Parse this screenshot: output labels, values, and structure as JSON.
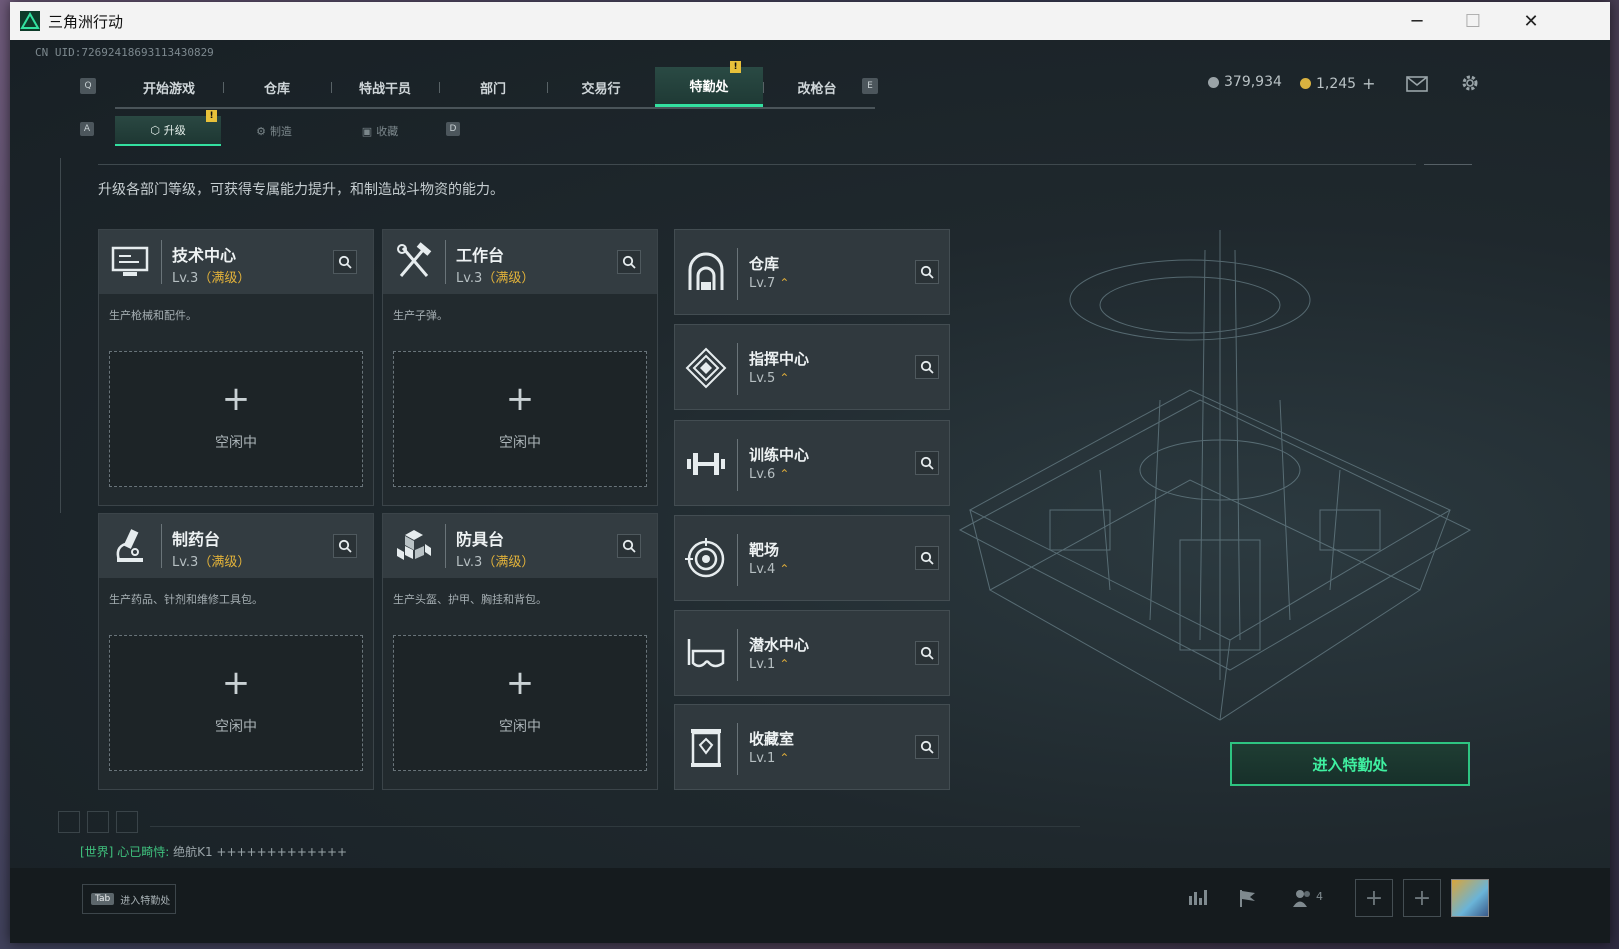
{
  "window": {
    "title": "三角洲行动",
    "minimize": "─",
    "maximize": "☐",
    "close": "✕"
  },
  "uid": "CN UID:726924186931134​30829",
  "nav": {
    "key_left": "Q",
    "key_right": "E",
    "tabs": [
      "开始游戏",
      "仓库",
      "特战干员",
      "部门",
      "交易行",
      "特勤处",
      "改枪台"
    ],
    "active_index": 5,
    "badge": "!"
  },
  "currency": {
    "coins": "379,934",
    "bonds": "1,245",
    "add": "+"
  },
  "subnav": {
    "key_left": "A",
    "key_right": "D",
    "tabs": [
      "升级",
      "制造",
      "收藏"
    ],
    "active_index": 0,
    "badge": "!"
  },
  "description": "升级各部门等级，可获得专属能力提升，和制造战斗物资的能力。",
  "workstations": [
    {
      "name": "技术中心",
      "level": "Lv.3",
      "max": "（满级）",
      "desc": "生产枪械和配件。",
      "icon": "computer-icon",
      "slot_plus": "+",
      "slot_status": "空闲中"
    },
    {
      "name": "工作台",
      "level": "Lv.3",
      "max": "（满级）",
      "desc": "生产子弹。",
      "icon": "tools-icon",
      "slot_plus": "+",
      "slot_status": "空闲中"
    },
    {
      "name": "制药台",
      "level": "Lv.3",
      "max": "（满级）",
      "desc": "生产药品、针剂和维修工具包。",
      "icon": "microscope-icon",
      "slot_plus": "+",
      "slot_status": "空闲中"
    },
    {
      "name": "防具台",
      "level": "Lv.3",
      "max": "（满级）",
      "desc": "生产头盔、护甲、胸挂和背包。",
      "icon": "armor-cubes-icon",
      "slot_plus": "+",
      "slot_status": "空闲中"
    }
  ],
  "departments": [
    {
      "name": "仓库",
      "level": "Lv.7",
      "icon": "warehouse-icon"
    },
    {
      "name": "指挥中心",
      "level": "Lv.5",
      "icon": "command-diamond-icon"
    },
    {
      "name": "训练中心",
      "level": "Lv.6",
      "icon": "dumbbell-icon"
    },
    {
      "name": "靶场",
      "level": "Lv.4",
      "icon": "target-icon"
    },
    {
      "name": "潜水中心",
      "level": "Lv.1",
      "icon": "diving-mask-icon"
    },
    {
      "name": "收藏室",
      "level": "Lv.1",
      "icon": "trophy-case-icon"
    }
  ],
  "upgrade_mark": "⌃",
  "enter_button": "进入特勤处",
  "chat": {
    "channel": "[世界]",
    "sender": "心已畸恃:",
    "message": "绝航K1 +++++++++++++"
  },
  "bottom": {
    "tab_key": "Tab",
    "tab_label": "进入特勤处",
    "friends_count": "4",
    "add": "+"
  },
  "colors": {
    "accent": "#33e0a0",
    "max_level": "#e2b23a",
    "enter_button_text": "#3ff0a0"
  }
}
